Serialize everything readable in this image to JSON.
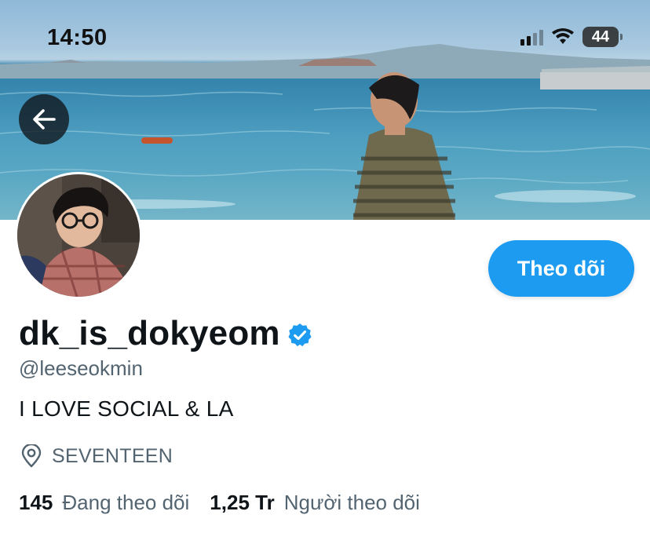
{
  "status_bar": {
    "time": "14:50",
    "battery": "44",
    "icons": [
      "signal-icon",
      "wifi-icon",
      "battery-icon"
    ]
  },
  "header": {
    "back_icon": "arrow-left-icon"
  },
  "profile": {
    "display_name": "dk_is_dokyeom",
    "handle": "@leeseokmin",
    "bio": "I LOVE SOCIAL & LA",
    "location": "SEVENTEEN",
    "follow_label": "Theo dõi",
    "following_count": "145",
    "following_label": "Đang theo dõi",
    "followers_count": "1,25 Tr",
    "followers_label": "Người theo dõi"
  },
  "colors": {
    "accent": "#1d9bf0",
    "text_primary": "#0f1419",
    "text_secondary": "#536471",
    "verified": "#1d9bf0"
  }
}
